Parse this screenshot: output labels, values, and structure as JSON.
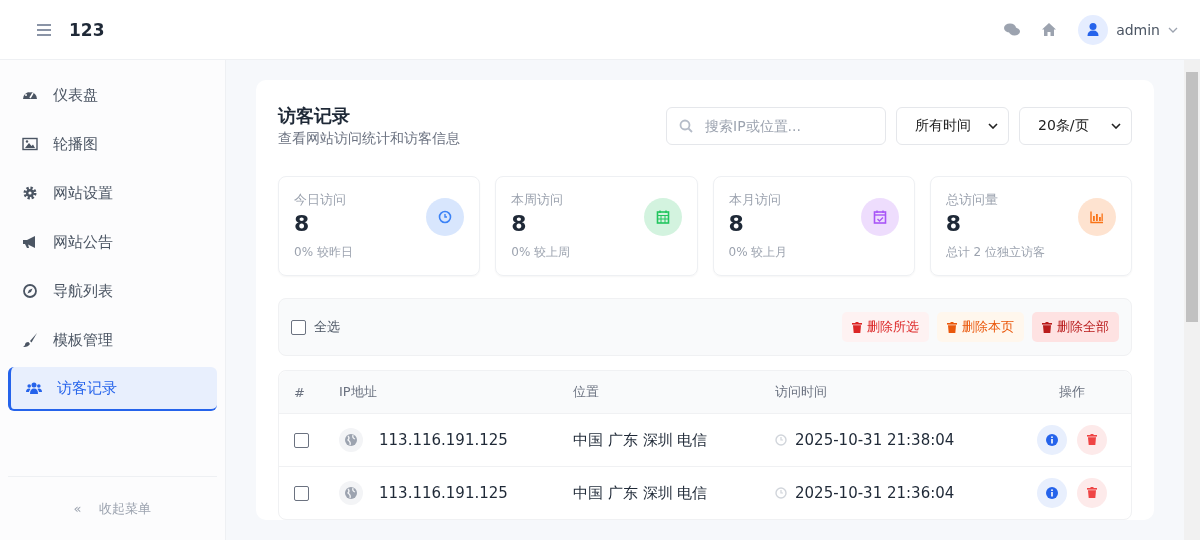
{
  "header": {
    "brand": "123",
    "user": "admin"
  },
  "sidebar": {
    "items": [
      {
        "label": "仪表盘",
        "selected": false
      },
      {
        "label": "轮播图",
        "selected": false
      },
      {
        "label": "网站设置",
        "selected": false
      },
      {
        "label": "网站公告",
        "selected": false
      },
      {
        "label": "导航列表",
        "selected": false
      },
      {
        "label": "模板管理",
        "selected": false
      },
      {
        "label": "访客记录",
        "selected": true
      }
    ],
    "collapse": {
      "icon": "«",
      "label": "收起菜单"
    }
  },
  "page": {
    "title": "访客记录",
    "subtitle": "查看网站访问统计和访客信息",
    "search": {
      "placeholder": "搜索IP或位置..."
    },
    "selects": [
      {
        "value": "所有时间"
      },
      {
        "value": "20条/页"
      }
    ]
  },
  "stats": [
    {
      "label": "今日访问",
      "value": "8",
      "note": "0% 较昨日"
    },
    {
      "label": "本周访问",
      "value": "8",
      "note": "0% 较上周"
    },
    {
      "label": "本月访问",
      "value": "8",
      "note": "0% 较上月"
    },
    {
      "label": "总访问量",
      "value": "8",
      "note": "总计 2 位独立访客"
    }
  ],
  "toolbar": {
    "select_all": {
      "label": "全选",
      "checked": false
    },
    "buttons": [
      {
        "label": "删除所选",
        "kind": "danger"
      },
      {
        "label": "删除本页",
        "kind": "warning"
      },
      {
        "label": "删除全部",
        "kind": "danger-strong"
      }
    ]
  },
  "table": {
    "columns": [
      "#",
      "IP地址",
      "位置",
      "访问时间",
      "操作"
    ],
    "rows": [
      {
        "checked": false,
        "ip": "113.116.191.125",
        "location": "中国 广东 深圳 电信",
        "time": "2025-10-31 21:38:04"
      },
      {
        "checked": false,
        "ip": "113.116.191.125",
        "location": "中国 广东 深圳 电信",
        "time": "2025-10-31 21:36:04"
      }
    ]
  }
}
